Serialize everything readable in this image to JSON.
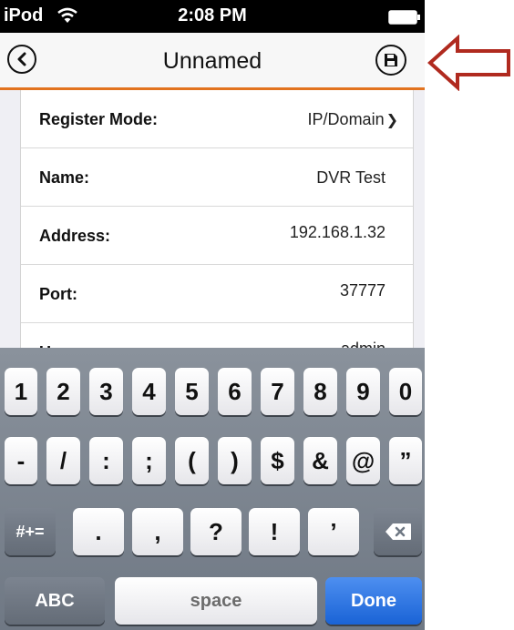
{
  "statusbar": {
    "device": "iPod",
    "time": "2:08 PM",
    "wifi_icon": "wifi-icon",
    "battery_icon": "battery-icon"
  },
  "navbar": {
    "title": "Unnamed",
    "back_icon": "back-chevron-icon",
    "save_icon": "save-disk-icon",
    "accent_color": "#e2731f"
  },
  "form": {
    "rows": [
      {
        "label": "Register Mode:",
        "value": "IP/Domain",
        "has_arrow": true
      },
      {
        "label": "Name:",
        "value": "DVR Test"
      },
      {
        "label": "Address:",
        "value": "192.168.1.32"
      },
      {
        "label": "Port:",
        "value": "37777"
      },
      {
        "label": "Username:",
        "value": "admin"
      }
    ]
  },
  "keyboard": {
    "row1": [
      "1",
      "2",
      "3",
      "4",
      "5",
      "6",
      "7",
      "8",
      "9",
      "0"
    ],
    "row2": [
      "-",
      "/",
      ":",
      ";",
      "(",
      ")",
      "$",
      "&",
      "@",
      "”"
    ],
    "row3": {
      "symbols_key": "#+=",
      "keys": [
        ".",
        ",",
        "?",
        "!",
        "’"
      ],
      "delete_icon": "backspace-icon"
    },
    "row4": {
      "abc": "ABC",
      "space": "space",
      "done": "Done"
    },
    "done_color": "#1a63d6"
  },
  "annotation": {
    "arrow_icon": "red-arrow-icon",
    "color": "#b02a1f"
  }
}
